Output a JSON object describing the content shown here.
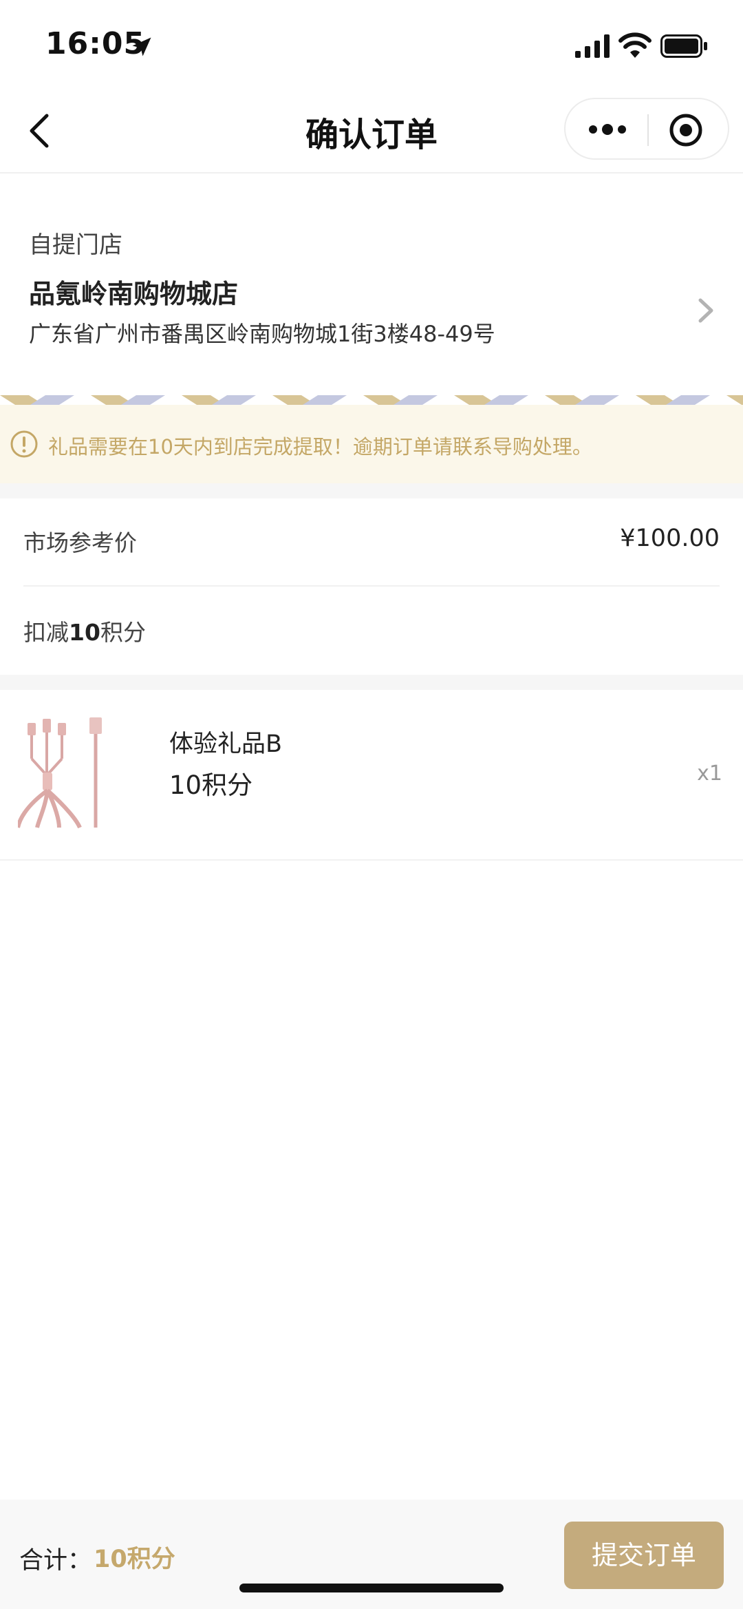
{
  "status_bar": {
    "time": "16:05"
  },
  "nav": {
    "title": "确认订单"
  },
  "store": {
    "label": "自提门店",
    "name": "品氪岭南购物城店",
    "address": "广东省广州市番禺区岭南购物城1街3楼48-49号"
  },
  "notice": {
    "text": "礼品需要在10天内到店完成提取！逾期订单请联系导购处理。"
  },
  "pricing": {
    "market_label": "市场参考价",
    "market_value": "¥100.00",
    "deduct_prefix": "扣减",
    "deduct_amount": "10",
    "deduct_suffix": "积分"
  },
  "product": {
    "name": "体验礼品B",
    "points": "10积分",
    "quantity": "x1"
  },
  "footer": {
    "total_label": "合计：",
    "total_value": "10积分",
    "submit_label": "提交订单"
  },
  "colors": {
    "accent_gold": "#c5a86c",
    "button_gold": "#c4ab7d",
    "notice_bg": "#fbf7ea",
    "stripe_tan": "#d8c596",
    "stripe_blue": "#c4c8e0"
  },
  "icons": {
    "back": "chevron-left-icon",
    "more": "more-dots-icon",
    "close": "target-close-icon",
    "chevron": "chevron-right-icon",
    "notice": "exclamation-circle-icon"
  }
}
